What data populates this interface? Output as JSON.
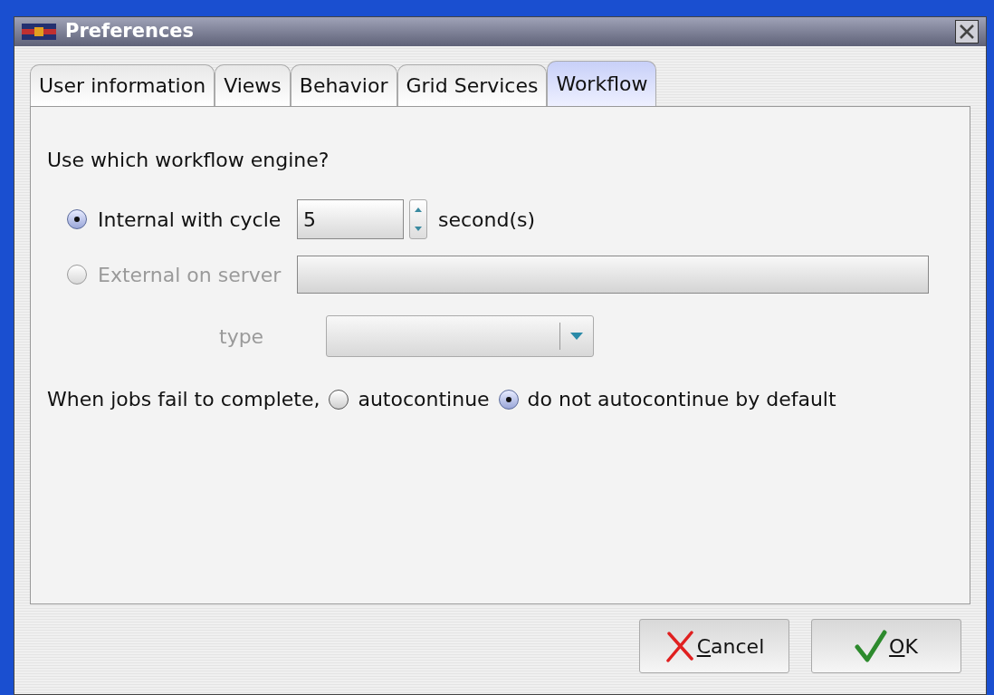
{
  "window": {
    "title": "Preferences"
  },
  "tabs": [
    {
      "label": "User information",
      "selected": false
    },
    {
      "label": "Views",
      "selected": false
    },
    {
      "label": "Behavior",
      "selected": false
    },
    {
      "label": "Grid Services",
      "selected": false
    },
    {
      "label": "Workflow",
      "selected": true
    }
  ],
  "engine": {
    "question": "Use which workflow engine?",
    "internal": {
      "label": "Internal with cycle",
      "selected": true,
      "disabled": false,
      "cycle_value": "5",
      "unit": "second(s)"
    },
    "external": {
      "label": "External on server",
      "selected": false,
      "disabled": true,
      "type_label": "type"
    }
  },
  "failure": {
    "label": "When jobs fail to complete,",
    "options": [
      {
        "label": "autocontinue",
        "selected": false
      },
      {
        "label": "do not autocontinue by default",
        "selected": true
      }
    ]
  },
  "buttons": [
    {
      "kind": "cancel",
      "label": "Cancel"
    },
    {
      "kind": "ok",
      "label": "OK"
    }
  ]
}
